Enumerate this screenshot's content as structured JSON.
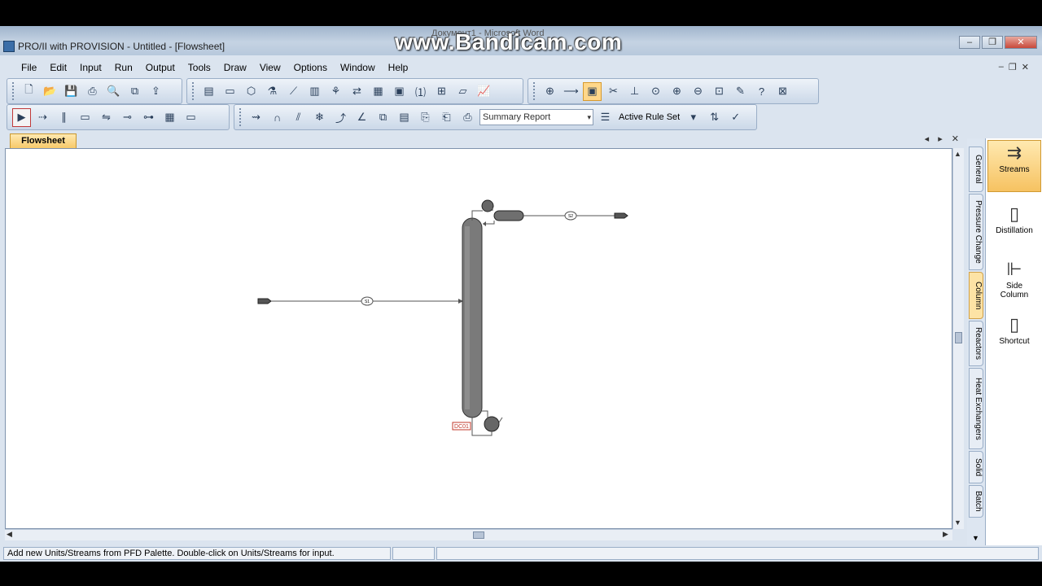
{
  "watermark": "www.Bandicam.com",
  "background_window_title": "Документ1 - Microsoft Word",
  "window": {
    "title": "PRO/II with PROVISION - Untitled - [Flowsheet]",
    "minimize": "–",
    "restore": "❐",
    "close": "✕"
  },
  "menu": [
    "File",
    "Edit",
    "Input",
    "Run",
    "Output",
    "Tools",
    "Draw",
    "View",
    "Options",
    "Window",
    "Help"
  ],
  "mdi_controls": {
    "minimize": "–",
    "restore": "❐",
    "close": "✕"
  },
  "toolbar": {
    "report_select": "Summary Report",
    "rule_set_label": "Active Rule Set"
  },
  "document_tab": "Flowsheet",
  "tab_nav": "◂ ▸ ✕",
  "flowsheet": {
    "streams": [
      "S1",
      "S2"
    ],
    "unit": "DC01"
  },
  "palette": {
    "categories": [
      "General",
      "Pressure Change",
      "Column",
      "Reactors",
      "Heat Exchangers",
      "Solid",
      "Batch"
    ],
    "active_category": "Column",
    "items": [
      "Streams",
      "Distillation",
      "Side Column",
      "Shortcut"
    ]
  },
  "status": {
    "message": "Add new Units/Streams from PFD Palette.  Double-click on Units/Streams for input."
  },
  "colors": {
    "accent": "#f7c96a",
    "unit_label": "#c0392b"
  }
}
